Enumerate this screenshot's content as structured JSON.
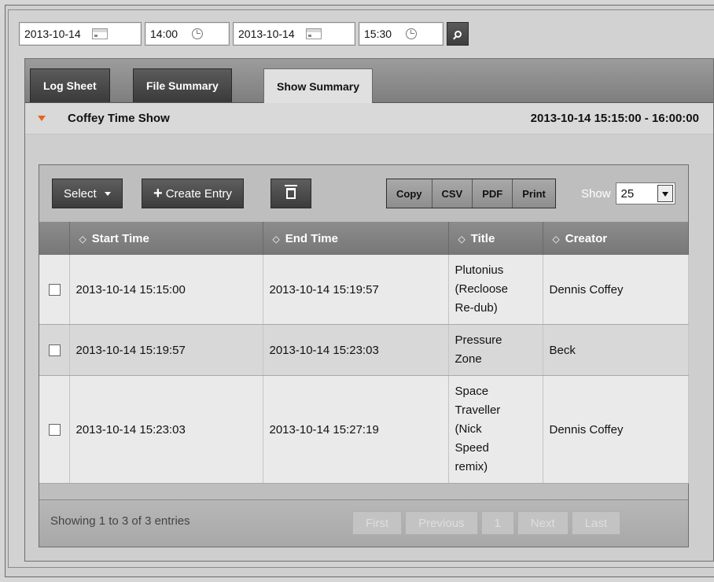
{
  "filter": {
    "start_date": "2013-10-14",
    "start_time": "14:00",
    "end_date": "2013-10-14",
    "end_time": "15:30"
  },
  "tabs": [
    {
      "label": "Log Sheet"
    },
    {
      "label": "File Summary"
    },
    {
      "label": "Show Summary",
      "active": true
    }
  ],
  "show": {
    "title": "Coffey Time Show",
    "range": "2013-10-14   15:15:00 - 16:00:00"
  },
  "toolbar": {
    "select_label": "Select",
    "create_label": "Create Entry",
    "export": [
      "Copy",
      "CSV",
      "PDF",
      "Print"
    ],
    "show_label": "Show",
    "show_value": "25"
  },
  "table": {
    "headers": [
      "Start Time",
      "End Time",
      "Title",
      "Creator"
    ],
    "rows": [
      {
        "start": "2013-10-14 15:15:00",
        "end": "2013-10-14 15:19:57",
        "title": [
          "Plutonius",
          "(Recloose",
          "Re-dub)"
        ],
        "creator": "Dennis Coffey"
      },
      {
        "start": "2013-10-14 15:19:57",
        "end": "2013-10-14 15:23:03",
        "title": [
          "Pressure",
          "Zone"
        ],
        "creator": "Beck"
      },
      {
        "start": "2013-10-14 15:23:03",
        "end": "2013-10-14 15:27:19",
        "title": [
          "Space",
          "Traveller",
          "(Nick",
          "Speed",
          "remix)"
        ],
        "creator": "Dennis Coffey"
      }
    ]
  },
  "footer": {
    "info": "Showing 1 to 3 of 3 entries",
    "pager": [
      "First",
      "Previous",
      "1",
      "Next",
      "Last"
    ]
  }
}
